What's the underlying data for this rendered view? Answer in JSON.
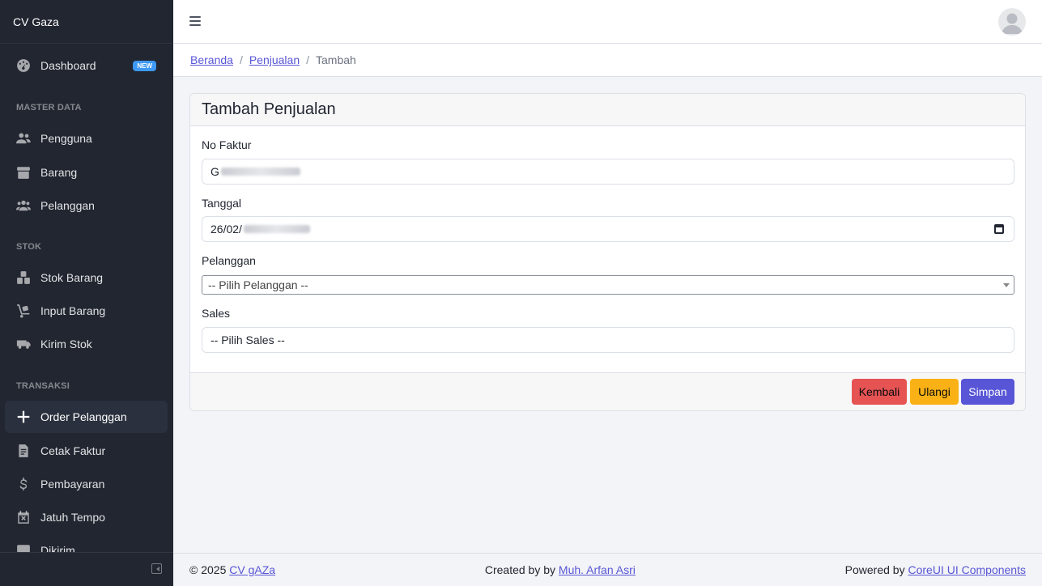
{
  "sidebar": {
    "brand": "CV Gaza",
    "dashboard": {
      "label": "Dashboard",
      "badge": "NEW",
      "icon": "speedometer-icon"
    },
    "sections": {
      "master": "MASTER DATA",
      "stok": "STOK",
      "transaksi": "TRANSAKSI"
    },
    "items": {
      "pengguna": "Pengguna",
      "barang": "Barang",
      "pelanggan": "Pelanggan",
      "stok_barang": "Stok Barang",
      "input_barang": "Input Barang",
      "kirim_stok": "Kirim Stok",
      "order_pelanggan": "Order Pelanggan",
      "cetak_faktur": "Cetak Faktur",
      "pembayaran": "Pembayaran",
      "jatuh_tempo": "Jatuh Tempo",
      "dikirim": "Dikirim"
    }
  },
  "breadcrumb": {
    "home": "Beranda",
    "parent": "Penjualan",
    "current": "Tambah",
    "separator": "/"
  },
  "form": {
    "title": "Tambah Penjualan",
    "no_faktur": {
      "label": "No Faktur",
      "value": "G"
    },
    "tanggal": {
      "label": "Tanggal",
      "value": "26/02/"
    },
    "pelanggan": {
      "label": "Pelanggan",
      "value": "-- Pilih Pelanggan --"
    },
    "sales": {
      "label": "Sales",
      "value": "-- Pilih Sales --"
    }
  },
  "buttons": {
    "kembali": "Kembali",
    "ulangi": "Ulangi",
    "simpan": "Simpan"
  },
  "footer": {
    "copyright": "© 2025",
    "company_link": "CV gAZa",
    "created_by": "Created by by",
    "author_link": "Muh. Arfan Asri",
    "powered_by": "Powered by",
    "powered_link": "CoreUI UI Components"
  },
  "colors": {
    "sidebar_bg": "#212631",
    "primary": "#5856d6",
    "danger": "#e55353",
    "warning": "#f9b115",
    "badge": "#3d99f5"
  }
}
